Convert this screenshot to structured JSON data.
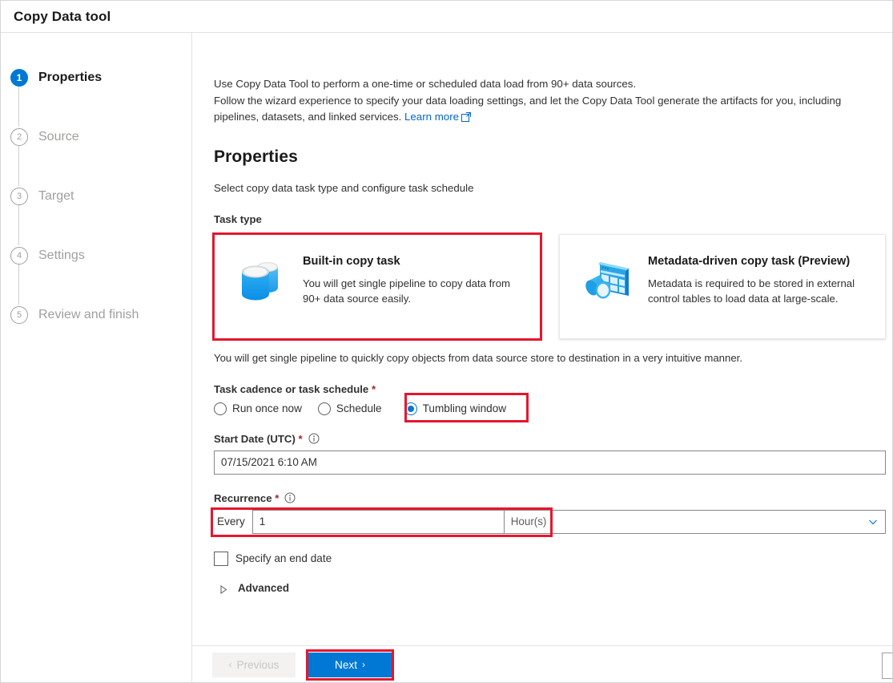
{
  "window": {
    "title": "Copy Data tool"
  },
  "sidebar": {
    "steps": [
      {
        "num": "1",
        "label": "Properties",
        "state": "active"
      },
      {
        "num": "2",
        "label": "Source",
        "state": "upcoming"
      },
      {
        "num": "3",
        "label": "Target",
        "state": "upcoming"
      },
      {
        "num": "4",
        "label": "Settings",
        "state": "upcoming"
      },
      {
        "num": "5",
        "label": "Review and finish",
        "state": "upcoming"
      }
    ]
  },
  "main": {
    "intro_line1": "Use Copy Data Tool to perform a one-time or scheduled data load from 90+ data sources.",
    "intro_line2": "Follow the wizard experience to specify your data loading settings, and let the Copy Data Tool generate the artifacts for you, including",
    "intro_line3_prefix": "pipelines, datasets, and linked services.",
    "learn_more": "Learn more",
    "section_title": "Properties",
    "section_sub": "Select copy data task type and configure task schedule",
    "task_type_label": "Task type",
    "cards": [
      {
        "title": "Built-in copy task",
        "desc": "You will get single pipeline to copy data from 90+ data source easily.",
        "icon": "database-stack-icon",
        "selected": true
      },
      {
        "title": "Metadata-driven copy task (Preview)",
        "desc": "Metadata is required to be stored in external control tables to load data at large-scale.",
        "icon": "metadata-table-icon",
        "selected": false
      }
    ],
    "note": "You will get single pipeline to quickly copy objects from data source store to destination in a very intuitive manner.",
    "cadence": {
      "label": "Task cadence or task schedule",
      "required": "*",
      "options": [
        {
          "label": "Run once now",
          "checked": false
        },
        {
          "label": "Schedule",
          "checked": false
        },
        {
          "label": "Tumbling window",
          "checked": true
        }
      ]
    },
    "start_date": {
      "label": "Start Date (UTC)",
      "required": "*",
      "value": "07/15/2021 6:10 AM"
    },
    "recurrence": {
      "label": "Recurrence",
      "required": "*",
      "every_label": "Every",
      "value": "1",
      "unit": "Hour(s)"
    },
    "end_date_checkbox": {
      "label": "Specify an end date",
      "checked": false
    },
    "advanced": {
      "label": "Advanced",
      "expanded": false
    }
  },
  "footer": {
    "previous": "Previous",
    "previous_glyph": "‹",
    "next": "Next",
    "next_glyph": "›"
  },
  "colors": {
    "accent": "#0078d4",
    "highlight": "#e6162d",
    "required": "#a4262c",
    "link": "#0066cc",
    "muted": "#a19f9d"
  }
}
